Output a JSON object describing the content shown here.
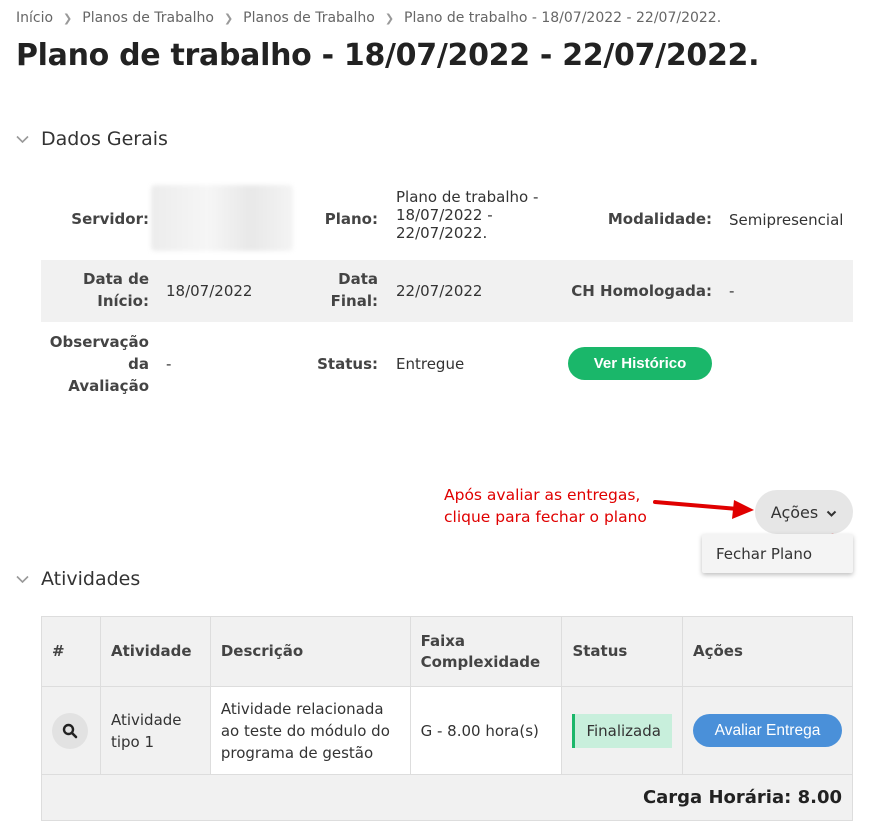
{
  "breadcrumb": [
    "Início",
    "Planos de Trabalho",
    "Planos de Trabalho",
    "Plano de trabalho - 18/07/2022 - 22/07/2022."
  ],
  "page_title": "Plano de trabalho - 18/07/2022 - 22/07/2022.",
  "dados_gerais": {
    "section_title": "Dados Gerais",
    "servidor_label": "Servidor:",
    "plano_label": "Plano:",
    "plano_value": [
      "Plano de trabalho -",
      "18/07/2022 -",
      "22/07/2022."
    ],
    "modalidade_label": "Modalidade:",
    "modalidade_value": "Semipresencial",
    "data_inicio_label": [
      "Data de",
      "Início:"
    ],
    "data_inicio_value": "18/07/2022",
    "data_final_label": [
      "Data",
      "Final:"
    ],
    "data_final_value": "22/07/2022",
    "ch_homologada_label": "CH Homologada:",
    "ch_homologada_value": "-",
    "observacao_label": [
      "Observação",
      "da",
      "Avaliação"
    ],
    "observacao_value": "-",
    "status_label": "Status:",
    "status_value": "Entregue",
    "ver_historico": "Ver Histórico"
  },
  "annotation": [
    "Após avaliar as entregas,",
    "clique para fechar o plano"
  ],
  "acoes_menu": {
    "button_label": "Ações",
    "items": [
      "Fechar Plano"
    ]
  },
  "atividades": {
    "section_title": "Atividades",
    "columns": [
      "#",
      "Atividade",
      "Descrição",
      [
        "Faixa",
        "Complexidade"
      ],
      "Status",
      "Ações"
    ],
    "rows": [
      {
        "atividade": [
          "Atividade",
          "tipo 1"
        ],
        "descricao": [
          "Atividade relacionada",
          "ao teste do módulo do",
          "programa de gestão"
        ],
        "faixa": "G - 8.00 hora(s)",
        "status": "Finalizada",
        "acao": "Avaliar Entrega"
      }
    ],
    "total": "Carga Horária: 8.00"
  },
  "colors": {
    "accent_green": "#1ab76a",
    "accent_blue": "#4a90d9",
    "annotation_red": "#e00000"
  }
}
